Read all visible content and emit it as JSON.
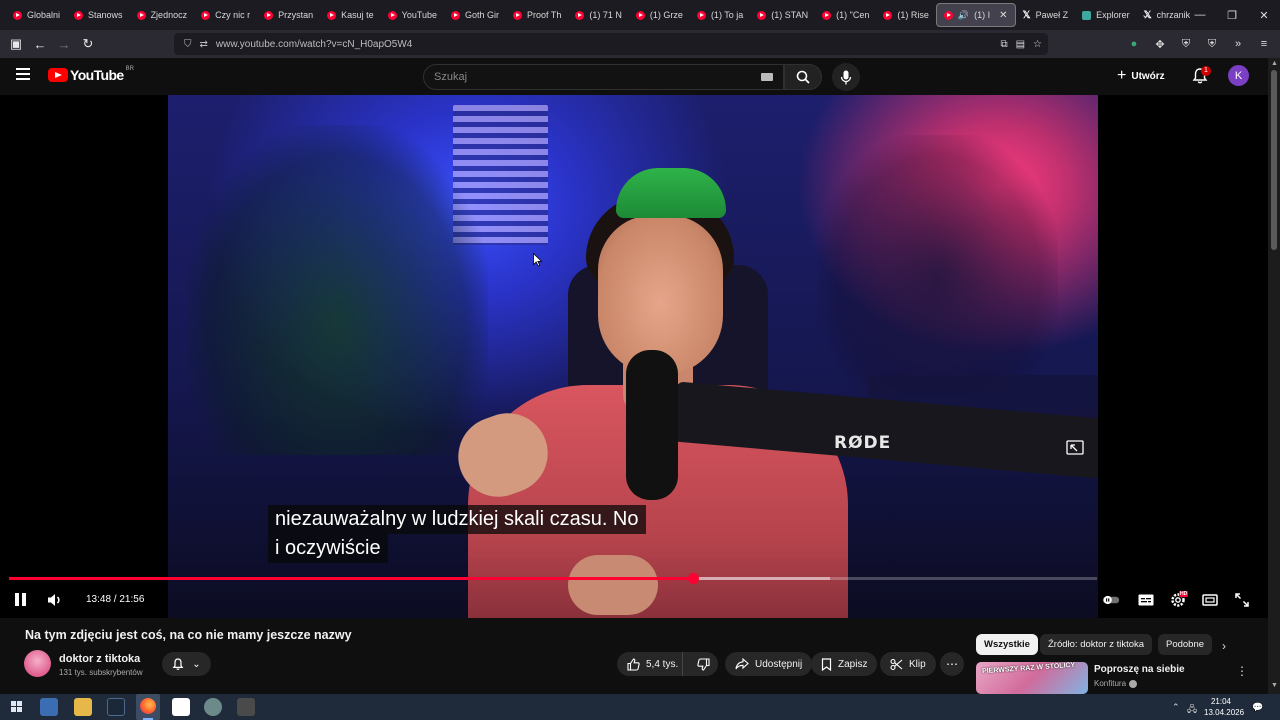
{
  "browser": {
    "tabs": [
      {
        "label": "Globalni",
        "icon": "youtube-icon"
      },
      {
        "label": "Stanows",
        "icon": "youtube-icon"
      },
      {
        "label": "Zjednocz",
        "icon": "youtube-icon"
      },
      {
        "label": "Czy nic r",
        "icon": "youtube-icon"
      },
      {
        "label": "Przystan",
        "icon": "youtube-icon"
      },
      {
        "label": "Kasuj te",
        "icon": "youtube-icon"
      },
      {
        "label": "YouTube",
        "icon": "youtube-icon"
      },
      {
        "label": "Goth Gir",
        "icon": "youtube-icon"
      },
      {
        "label": "Proof Th",
        "icon": "youtube-icon"
      },
      {
        "label": "(1) 71 N",
        "icon": "youtube-icon"
      },
      {
        "label": "(1) Grze",
        "icon": "youtube-icon"
      },
      {
        "label": "(1) To ja",
        "icon": "youtube-icon"
      },
      {
        "label": "(1) STAN",
        "icon": "youtube-icon"
      },
      {
        "label": "(1) \"Cen",
        "icon": "youtube-icon"
      },
      {
        "label": "(1) Rise",
        "icon": "youtube-icon"
      }
    ],
    "active_tab": {
      "label": "(1) I",
      "icon": "youtube-icon"
    },
    "extra_tabs": [
      {
        "label": "Paweł Z",
        "icon": "x-icon"
      },
      {
        "label": "Explorer",
        "icon": "explorer-icon"
      },
      {
        "label": "chrzanik",
        "icon": "x-icon"
      }
    ],
    "url": "www.youtube.com/watch?v=cN_H0apO5W4"
  },
  "youtube": {
    "logo_text": "YouTube",
    "country_code": "BR",
    "search_placeholder": "Szukaj",
    "create_label": "Utwórz",
    "notification_count": "1",
    "avatar_letter": "K"
  },
  "player": {
    "caption_line1": "niezauważalny w ludzkiej skali czasu. No",
    "caption_line2": "i oczywiście",
    "current_time": "13:48",
    "duration": "21:56",
    "time_display": "13:48 / 21:56",
    "progress_fraction": 0.629,
    "buffer_fraction": 0.755,
    "mic_brand": "RØDE",
    "hd_badge": "HD"
  },
  "video": {
    "title": "Na tym zdjęciu jest coś, na co nie mamy jeszcze nazwy",
    "channel_name": "doktor z tiktoka",
    "subscribers": "131 tys. subskrybentów",
    "likes": "5,4 tys.",
    "share_label": "Udostępnij",
    "save_label": "Zapisz",
    "clip_label": "Klip"
  },
  "sidebar": {
    "chips": [
      "Wszystkie",
      "Źródło: doktor z tiktoka",
      "Podobne"
    ],
    "rec": {
      "thumb_text": "PIERWSZY RAZ W STOLICY",
      "title": "Poproszę na siebie",
      "channel": "Konfitura"
    }
  },
  "taskbar": {
    "time": "21:04",
    "date": "13.04.2026"
  },
  "colors": {
    "accent_red": "#ff0033",
    "background": "#0f0f0f",
    "avatar_purple": "#7b3fc4"
  }
}
